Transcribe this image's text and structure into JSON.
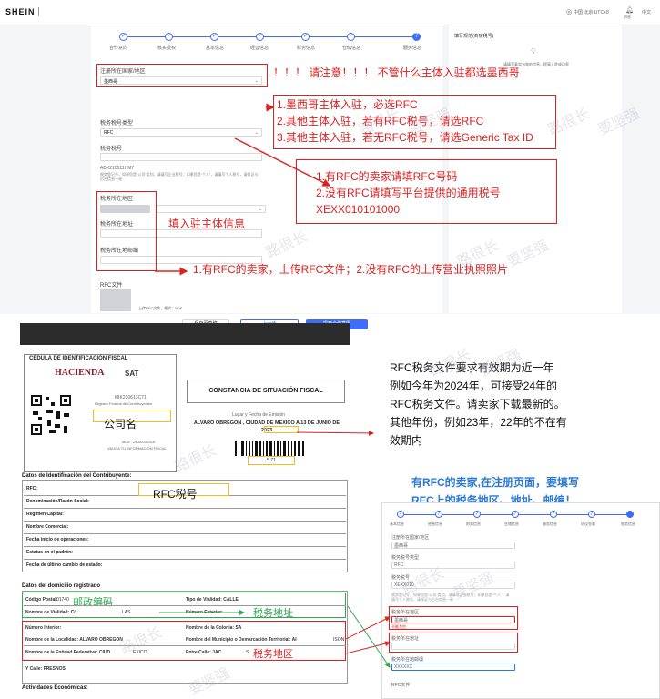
{
  "header": {
    "logo": "SHEIN",
    "region": "中国 北京 UTC+8",
    "message_label": "消息",
    "language": "中文"
  },
  "steps": [
    "合作意向",
    "核实授权",
    "基本信息",
    "经营信息",
    "财务信息",
    "仓储信息",
    "服务信息"
  ],
  "active_step": "7",
  "form": {
    "field_country": "注册所在国家/地区",
    "country_value": "墨西哥",
    "field_tax_type": "税务税号类型",
    "tax_type_value": "RFC",
    "field_tax_no": "税务税号",
    "tax_no_value": "ADK210511HM7",
    "tax_hint": "税务登记号，如果您是“公司”类别，请填写企业税号；如果您是“个人”，请填写个人税号，请保证与后台信息一致",
    "field_tax_region": "税务所在地区",
    "field_tax_address": "税务所在地址",
    "field_zip": "税务所在地邮编",
    "field_rfc_file": "RFC文件",
    "upload_hint": "上传RFC文件，格式：PDF",
    "btn_draft": "保存至草稿",
    "btn_prev": "上一步",
    "btn_submit": "提交合作意愿"
  },
  "side_panel": {
    "title": "填写规范(商家税号)",
    "hint": "请填写真实有效的信息，提高入驻成功率"
  },
  "annotations": {
    "a1": "！！！ 请注意！！！   不管什么主体入驻都选墨西哥",
    "a2_1": "1.墨西哥主体入驻，必选RFC",
    "a2_2": "2.其他主体入驻，若有RFC税号，请选RFC",
    "a2_3": "3.其他主体入驻，若无RFC税号，请选Generic Tax ID",
    "a3_1": "1.有RFC的卖家请填RFC号码",
    "a3_2": "2.没有RFC请填写平台提供的通用税号",
    "a3_3": "XEXX010101000",
    "a4": "填入驻主体信息",
    "a5": "1.有RFC的卖家，上传RFC文件；2.没有RFC的上传营业执照照片"
  },
  "document": {
    "cedula_title": "CÉDULA DE IDENTIFICACIÓN FISCAL",
    "hacienda": "HACIENDA",
    "sat": "SAT",
    "rfc_code": "MIK230613C71",
    "registro": "Registro Federal de Contribuyentes",
    "company_label": "公司名",
    "idcif": "idCIF: 23060156316",
    "valida": "VALIDA TU INFORMACIÓN FISCAL",
    "constancia": "CONSTANCIA DE SITUACIÓN FISCAL",
    "lugar": "Lugar y Fecha de Emisión",
    "lugar_value": "ALVARO OBREGON , CIUDAD DE MEXICO A 13 DE JUNIO DE 2023",
    "barcode_num": "5 71",
    "ident_title": "Datos de Identificación del Contribuyente:",
    "rfc_tax_label": "RFC税号",
    "rows": [
      "RFC:",
      "Denominación/Razón Social:",
      "Régimen Capital:",
      "Nombre Comercial:",
      "Fecha inicio de operaciones:",
      "Estatus en el padrón:",
      "Fecha de último cambio de estado:"
    ],
    "domicilio_title": "Datos del domicilio registrado",
    "cp_label": "Código Postal:",
    "cp_value": "01740",
    "zip_label": "邮政编码",
    "vialidad_tipo": "Tipo de Vialidad: CALLE",
    "vialidad_nombre": "Nombre de Vialidad: C/",
    "las": "LAS",
    "num_ext": "Número Exterior:",
    "tax_address_label": "税务地址",
    "num_int": "Número Interior:",
    "colonia": "Nombre de la Colonia: SA",
    "localidad": "Nombre de la Localidad: ALVARO OBREGON",
    "municipio": "Nombre del Municipio o Demarcación Territorial: AI",
    "ison": "ISON",
    "entidad": "Nombre de la Entidad Federativa: CIUD",
    "exico": "EXICO",
    "entre": "Entre Calle: JAC",
    "s": "S",
    "tax_region_label": "税务地区",
    "ycalle": "Y Calle: FRESNOS",
    "actividades": "Actividades Económicas:"
  },
  "notes": {
    "validity_1": "RFC税务文件要求有效期为近一年",
    "validity_2": "例如今年为2024年，可接受24年的",
    "validity_3": "RFC税务文件。请卖家下载最新的。",
    "validity_4": "其他年份，例如23年，22年的不在有",
    "validity_5": "效期内",
    "blue_1": "有RFC的卖家,在注册页面，要填写",
    "blue_2": "RFC上的税务地区、地址、邮编！"
  },
  "mini_form": {
    "steps": [
      "基本信息",
      "经营信息",
      "财务信息",
      "仓储信息",
      "服务信息",
      "协议签署",
      "税务信息"
    ],
    "f1": "注册所在国家/地区",
    "v1": "墨西哥",
    "f2": "税务税号类型",
    "v2": "RFC",
    "f3": "税务税号",
    "v3": "XEXX010",
    "f4": "税务所在地区",
    "v4": "墨西哥",
    "err": "不能为空",
    "f5": "税务所在地址",
    "f6": "税务所在地邮编",
    "v6": "XXXXXX",
    "f7": "RFC文件"
  },
  "watermark": [
    "路很长",
    "要坚强"
  ]
}
